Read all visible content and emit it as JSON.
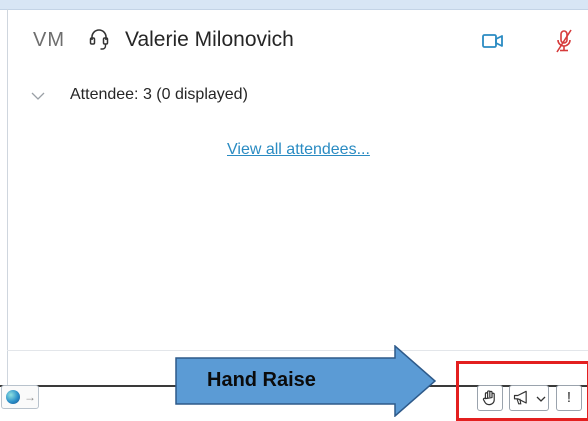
{
  "participant": {
    "initials": "VM",
    "name": "Valerie Milonovich",
    "icons": [
      "headset-icon",
      "video-camera-icon",
      "microphone-muted-icon"
    ]
  },
  "attendees": {
    "label": "Attendee: 3 (0 displayed)",
    "view_all_link": "View all attendees..."
  },
  "annotation": {
    "label": "Hand Raise"
  },
  "toolbar": {
    "buttons": [
      "hand-raise",
      "reactions",
      "more"
    ],
    "more_label": "!"
  },
  "colors": {
    "video_icon": "#2a8bc2",
    "mic_muted_icon": "#d63b3b",
    "link": "#2a8bc2",
    "annotation_arrow_fill": "#5b9bd5",
    "annotation_arrow_stroke": "#2e5a8a",
    "highlight_border": "#e31f1f",
    "top_strip": "#d8e6f5"
  }
}
